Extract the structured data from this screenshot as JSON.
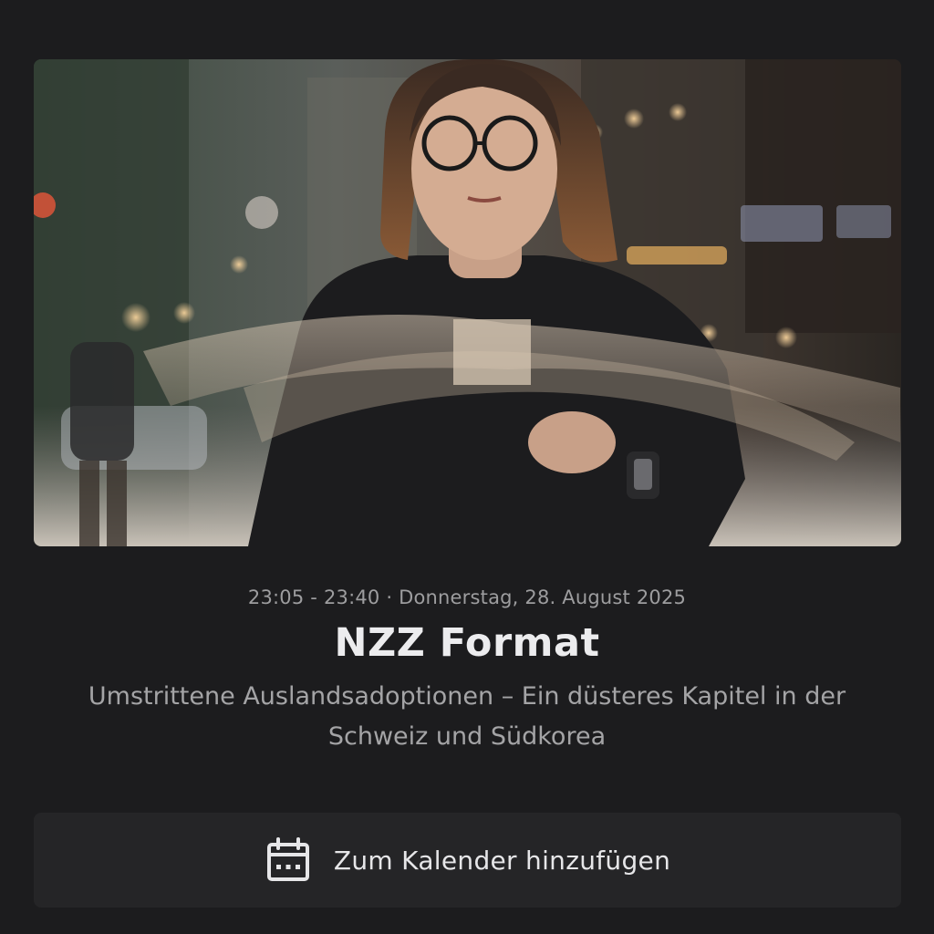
{
  "program": {
    "schedule": "23:05 - 23:40 · Donnerstag, 28. August 2025",
    "title": "NZZ Format",
    "subtitle": "Umstrittene Auslandsadoptionen – Ein düsteres Kapitel in der Schweiz und Südkorea"
  },
  "actions": {
    "add_to_calendar_label": "Zum Kalender hinzufügen",
    "add_to_calendar_icon": "calendar-icon"
  },
  "colors": {
    "background": "#1c1c1e",
    "button_background": "#252527",
    "title_text": "#ececee",
    "meta_text": "#9d9d9f"
  }
}
